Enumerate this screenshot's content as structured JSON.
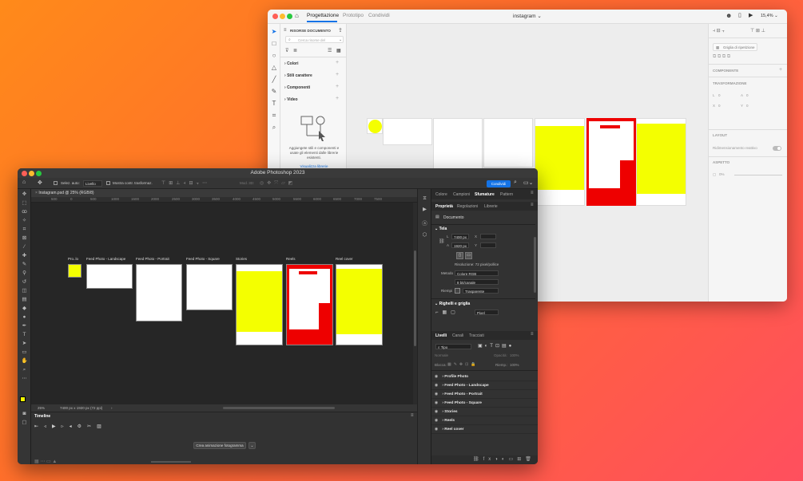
{
  "xd": {
    "title": "instagram",
    "tabs": [
      "Progettazione",
      "Prototipo",
      "Condividi"
    ],
    "zoom": "15,4%",
    "panel_title": "RISORSE DOCUMENTO",
    "search_placeholder": "Cerca risorse del",
    "sections": [
      "Colori",
      "Stili carattere",
      "Componenti",
      "Video"
    ],
    "empty_text": "Aggiungete stili e componenti e usate gli elementi dalle librerie esistenti.",
    "libraries_link": "Visualizza librerie",
    "right": {
      "grid_label": "Griglia di ripetizione",
      "component_label": "COMPONENTE",
      "transform_label": "TRASFORMAZIONE",
      "fields": [
        "L",
        "A",
        "X",
        "Y"
      ],
      "field_values": [
        "0",
        "0",
        "0",
        "0"
      ],
      "layout_label": "LAYOUT",
      "responsive_label": "Ridimensionamento reattivo",
      "appearance_label": "ASPETTO",
      "opacity_value": "0%"
    }
  },
  "ps": {
    "title": "Adobe Photoshop 2023",
    "doc_tab": "Instagram.psd @ 25% (RGB/8)",
    "options": {
      "auto_select": "Selez. auto:",
      "layer_select": "Livello",
      "transform": "Mostra contr. trasformaz.",
      "mode3d": "Mod. 3D:",
      "share": "Condividi"
    },
    "ruler": [
      "500",
      "0",
      "500",
      "1000",
      "1500",
      "2000",
      "2500",
      "3000",
      "3500",
      "4000",
      "4500",
      "5000",
      "5500",
      "6000",
      "6500",
      "7000",
      "7500"
    ],
    "artboards": [
      "Pro..lo",
      "Feed Photo - Landscape",
      "Feed Photo - Portrait",
      "Feed Photo - Square",
      "Stories",
      "Reels",
      "Reel cover"
    ],
    "status_zoom": "25%",
    "status_info": "7400 px x 1920 px (72 ppi)",
    "timeline_title": "Timeline",
    "timeline_button": "Crea animazione fotogramma",
    "top_tabs": [
      "Colore",
      "Campioni",
      "Sfumature",
      "Pattern"
    ],
    "prop_tabs": [
      "Proprietà",
      "Regolazioni",
      "Librerie"
    ],
    "document_label": "Documento",
    "canvas_section": "Tela",
    "width_label": "L",
    "width_value": "7400 px",
    "height_label": "A",
    "height_value": "1920 px",
    "x_label": "X",
    "y_label": "Y",
    "resolution": "Risoluzione: 72 pixel/pollice",
    "mode_label": "Metodo",
    "mode_value": "Colore RGB",
    "bits_value": "8 bit/canale",
    "fill_label": "Riempi",
    "fill_value": "Trasparente",
    "rulers_section": "Righelli e griglia",
    "units_value": "Pixel",
    "layer_tabs": [
      "Livelli",
      "Canali",
      "Tracciati"
    ],
    "kind_filter": "Tipo",
    "blend_mode": "Normale",
    "opacity_label": "Opacità:",
    "lock_label": "Blocca:",
    "fill_short": "Riemp.:",
    "percent": "100%",
    "layers": [
      "Profile Photo",
      "Feed Photo - Landscape",
      "Feed Photo - Portrait",
      "Feed Photo - Square",
      "Stories",
      "Reels",
      "Reel cover"
    ]
  },
  "colors": {
    "yellow": "#f4ff00",
    "red": "#ee0000",
    "accent": "#1473e6"
  }
}
